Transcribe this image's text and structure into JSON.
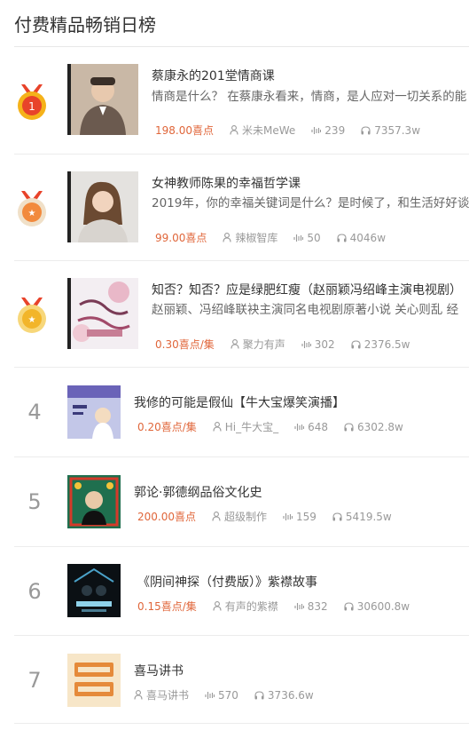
{
  "page": {
    "title": "付费精品畅销日榜"
  },
  "colors": {
    "price": "#e0663a",
    "medal_gold": "#f5b21a",
    "medal_red": "#e8432a"
  },
  "items": [
    {
      "rank": "1",
      "name": "蔡康永的201堂情商课",
      "desc": "情商是什么？ 在蔡康永看来，情商，是人应对一切关系的能",
      "price": "198.00喜点",
      "author": "米未MeWe",
      "tracks": "239",
      "plays": "7357.3w"
    },
    {
      "rank": "2",
      "name": "女神教师陈果的幸福哲学课",
      "desc": "2019年，你的幸福关键词是什么？是时候了，和生活好好谈",
      "price": "99.00喜点",
      "author": "辣椒智库",
      "tracks": "50",
      "plays": "4046w"
    },
    {
      "rank": "3",
      "name": "知否？知否？应是绿肥红瘦（赵丽颖冯绍峰主演电视剧）",
      "desc": "赵丽颖、冯绍峰联袂主演同名电视剧原著小说 关心则乱 经",
      "price": "0.30喜点/集",
      "author": "聚力有声",
      "tracks": "302",
      "plays": "2376.5w"
    },
    {
      "rank": "4",
      "name": "我修的可能是假仙【牛大宝爆笑演播】",
      "price": "0.20喜点/集",
      "author": "Hi_牛大宝_",
      "tracks": "648",
      "plays": "6302.8w"
    },
    {
      "rank": "5",
      "name": "郭论·郭德纲品俗文化史",
      "price": "200.00喜点",
      "author": "超级制作",
      "tracks": "159",
      "plays": "5419.5w"
    },
    {
      "rank": "6",
      "name": "《阴间神探（付费版）》紫襟故事",
      "price": "0.15喜点/集",
      "author": "有声的紫襟",
      "tracks": "832",
      "plays": "30600.8w"
    },
    {
      "rank": "7",
      "name": "喜马讲书",
      "price": "",
      "author": "喜马讲书",
      "tracks": "570",
      "plays": "3736.6w"
    }
  ]
}
